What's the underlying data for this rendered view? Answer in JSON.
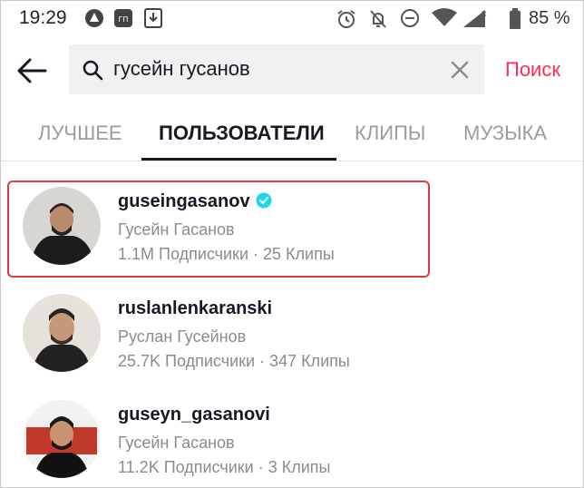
{
  "status_bar": {
    "time": "19:29",
    "battery_percent": "85 %",
    "icons": [
      "app-icon",
      "badge-icon",
      "download-icon",
      "alarm-icon",
      "bell-off-icon",
      "dnd-icon",
      "wifi-icon",
      "signal-icon",
      "battery-icon"
    ]
  },
  "search": {
    "query": "гусейн гусанов",
    "action_label": "Поиск"
  },
  "tabs": [
    {
      "label": "ЛУЧШЕЕ"
    },
    {
      "label": "ПОЛЬЗОВАТЕЛИ",
      "active": true
    },
    {
      "label": "КЛИПЫ"
    },
    {
      "label": "МУЗЫКА"
    }
  ],
  "results": [
    {
      "username": "guseingasanov",
      "full_name": "Гусейн Гасанов",
      "meta": "1.1M Подписчики · 25 Клипы",
      "verified": true,
      "highlighted": true
    },
    {
      "username": "ruslanlenkaranski",
      "full_name": "Руслан Гусейнов",
      "meta": "25.7K Подписчики · 347 Клипы",
      "verified": false
    },
    {
      "username": "guseyn_gasanovi",
      "full_name": "Гусейн Гасанов",
      "meta": "11.2K Подписчики · 3 Клипы",
      "verified": false
    }
  ],
  "colors": {
    "accent": "#fe2c55",
    "verified": "#20d5ec",
    "highlight_border": "#e03b3b"
  }
}
